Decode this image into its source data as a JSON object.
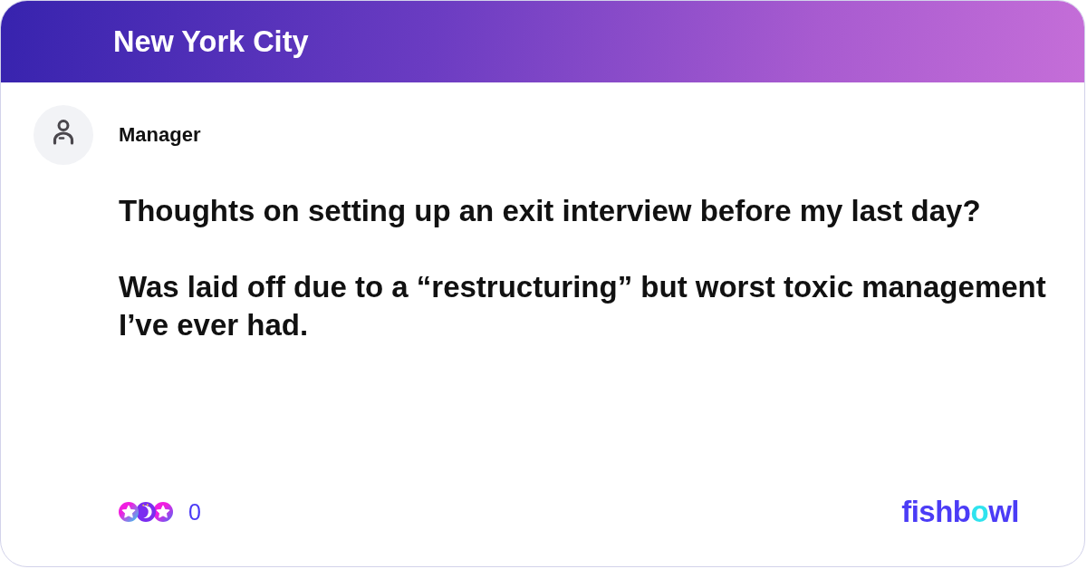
{
  "header": {
    "title": "New York City"
  },
  "post": {
    "author": "Manager",
    "title": "Thoughts on setting up an exit interview before my last day?",
    "body": "Was laid off due to a “restructuring” but worst toxic management I’ve ever had."
  },
  "reactions": {
    "count": "0"
  },
  "logo": {
    "segments": [
      {
        "text": "fishb",
        "color": "#4b3cf6"
      },
      {
        "text": "o",
        "color": "#2fe3ee"
      },
      {
        "text": "wl",
        "color": "#4b3cf6"
      }
    ]
  }
}
